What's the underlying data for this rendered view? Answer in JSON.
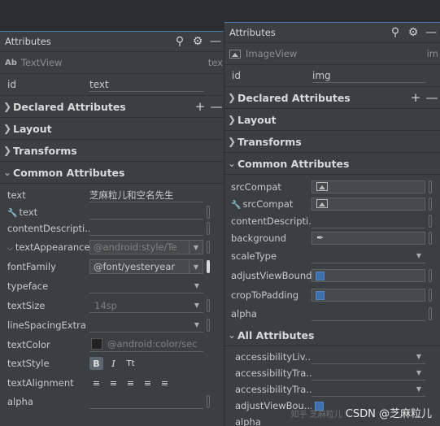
{
  "left_panel": {
    "title": "Attributes",
    "widget": {
      "icon": "Ab",
      "name": "TextView",
      "right_text": "tex"
    },
    "id": {
      "label": "id",
      "value": "text"
    },
    "sections": {
      "declared": "Declared Attributes",
      "layout": "Layout",
      "transforms": "Transforms",
      "common": "Common Attributes"
    },
    "attributes": {
      "text": {
        "label": "text",
        "value": "芝麻粒儿和空名先生"
      },
      "text_tools": {
        "label": "text"
      },
      "content_description": {
        "label": "contentDescripti..."
      },
      "text_appearance": {
        "label": "textAppearance",
        "value": "@android:style/Te"
      },
      "font_family": {
        "label": "fontFamily",
        "value": "@font/yesteryear"
      },
      "typeface": {
        "label": "typeface"
      },
      "text_size": {
        "label": "textSize",
        "value": "14sp"
      },
      "line_spacing_extra": {
        "label": "lineSpacingExtra"
      },
      "text_color": {
        "label": "textColor",
        "value": "@android:color/sec"
      },
      "text_style": {
        "label": "textStyle"
      },
      "text_alignment": {
        "label": "textAlignment"
      },
      "alpha": {
        "label": "alpha"
      }
    }
  },
  "right_panel": {
    "title": "Attributes",
    "widget": {
      "name": "ImageView",
      "right_text": "im"
    },
    "id": {
      "label": "id",
      "value": "img"
    },
    "sections": {
      "declared": "Declared Attributes",
      "layout": "Layout",
      "transforms": "Transforms",
      "common": "Common Attributes",
      "all": "All Attributes"
    },
    "attributes": {
      "src_compat": {
        "label": "srcCompat"
      },
      "src_compat_tools": {
        "label": "srcCompat"
      },
      "content_description": {
        "label": "contentDescripti..."
      },
      "background": {
        "label": "background"
      },
      "scale_type": {
        "label": "scaleType"
      },
      "adjust_view_bounds": {
        "label": "adjustViewBounds",
        "checked": true
      },
      "crop_to_padding": {
        "label": "cropToPadding",
        "checked": true
      },
      "alpha": {
        "label": "alpha"
      }
    },
    "all_attributes": [
      {
        "label": "accessibilityLiv..."
      },
      {
        "label": "accessibilityTra..."
      },
      {
        "label": "accessibilityTra..."
      },
      {
        "label": "adjustViewBou..."
      },
      {
        "label": "alpha"
      }
    ]
  },
  "watermark": {
    "faint": "知乎 芝麻粒儿",
    "text": "CSDN @芝麻粒儿"
  },
  "icons": [
    "search-icon",
    "gear-icon",
    "minimize-icon",
    "plus-icon",
    "minus-icon",
    "chevron-right-icon",
    "chevron-down-icon",
    "wrench-icon",
    "image-icon",
    "eyedropper-icon",
    "bold-icon",
    "italic-icon",
    "all-caps-icon",
    "align-left-icon",
    "align-center-icon",
    "align-right-icon"
  ],
  "colors": {
    "panel": "#3c3f41",
    "background": "#2b2d30",
    "accent": "#4a7bb3",
    "checkbox": "#3e6fae"
  }
}
